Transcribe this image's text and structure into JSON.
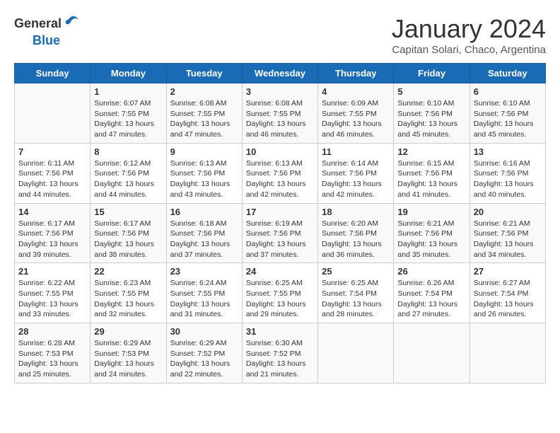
{
  "header": {
    "logo_general": "General",
    "logo_blue": "Blue",
    "title": "January 2024",
    "subtitle": "Capitan Solari, Chaco, Argentina"
  },
  "days": [
    "Sunday",
    "Monday",
    "Tuesday",
    "Wednesday",
    "Thursday",
    "Friday",
    "Saturday"
  ],
  "weeks": [
    [
      {
        "date": "",
        "info": ""
      },
      {
        "date": "1",
        "info": "Sunrise: 6:07 AM\nSunset: 7:55 PM\nDaylight: 13 hours\nand 47 minutes."
      },
      {
        "date": "2",
        "info": "Sunrise: 6:08 AM\nSunset: 7:55 PM\nDaylight: 13 hours\nand 47 minutes."
      },
      {
        "date": "3",
        "info": "Sunrise: 6:08 AM\nSunset: 7:55 PM\nDaylight: 13 hours\nand 46 minutes."
      },
      {
        "date": "4",
        "info": "Sunrise: 6:09 AM\nSunset: 7:55 PM\nDaylight: 13 hours\nand 46 minutes."
      },
      {
        "date": "5",
        "info": "Sunrise: 6:10 AM\nSunset: 7:56 PM\nDaylight: 13 hours\nand 45 minutes."
      },
      {
        "date": "6",
        "info": "Sunrise: 6:10 AM\nSunset: 7:56 PM\nDaylight: 13 hours\nand 45 minutes."
      }
    ],
    [
      {
        "date": "7",
        "info": "Sunrise: 6:11 AM\nSunset: 7:56 PM\nDaylight: 13 hours\nand 44 minutes."
      },
      {
        "date": "8",
        "info": "Sunrise: 6:12 AM\nSunset: 7:56 PM\nDaylight: 13 hours\nand 44 minutes."
      },
      {
        "date": "9",
        "info": "Sunrise: 6:13 AM\nSunset: 7:56 PM\nDaylight: 13 hours\nand 43 minutes."
      },
      {
        "date": "10",
        "info": "Sunrise: 6:13 AM\nSunset: 7:56 PM\nDaylight: 13 hours\nand 42 minutes."
      },
      {
        "date": "11",
        "info": "Sunrise: 6:14 AM\nSunset: 7:56 PM\nDaylight: 13 hours\nand 42 minutes."
      },
      {
        "date": "12",
        "info": "Sunrise: 6:15 AM\nSunset: 7:56 PM\nDaylight: 13 hours\nand 41 minutes."
      },
      {
        "date": "13",
        "info": "Sunrise: 6:16 AM\nSunset: 7:56 PM\nDaylight: 13 hours\nand 40 minutes."
      }
    ],
    [
      {
        "date": "14",
        "info": "Sunrise: 6:17 AM\nSunset: 7:56 PM\nDaylight: 13 hours\nand 39 minutes."
      },
      {
        "date": "15",
        "info": "Sunrise: 6:17 AM\nSunset: 7:56 PM\nDaylight: 13 hours\nand 38 minutes."
      },
      {
        "date": "16",
        "info": "Sunrise: 6:18 AM\nSunset: 7:56 PM\nDaylight: 13 hours\nand 37 minutes."
      },
      {
        "date": "17",
        "info": "Sunrise: 6:19 AM\nSunset: 7:56 PM\nDaylight: 13 hours\nand 37 minutes."
      },
      {
        "date": "18",
        "info": "Sunrise: 6:20 AM\nSunset: 7:56 PM\nDaylight: 13 hours\nand 36 minutes."
      },
      {
        "date": "19",
        "info": "Sunrise: 6:21 AM\nSunset: 7:56 PM\nDaylight: 13 hours\nand 35 minutes."
      },
      {
        "date": "20",
        "info": "Sunrise: 6:21 AM\nSunset: 7:56 PM\nDaylight: 13 hours\nand 34 minutes."
      }
    ],
    [
      {
        "date": "21",
        "info": "Sunrise: 6:22 AM\nSunset: 7:55 PM\nDaylight: 13 hours\nand 33 minutes."
      },
      {
        "date": "22",
        "info": "Sunrise: 6:23 AM\nSunset: 7:55 PM\nDaylight: 13 hours\nand 32 minutes."
      },
      {
        "date": "23",
        "info": "Sunrise: 6:24 AM\nSunset: 7:55 PM\nDaylight: 13 hours\nand 31 minutes."
      },
      {
        "date": "24",
        "info": "Sunrise: 6:25 AM\nSunset: 7:55 PM\nDaylight: 13 hours\nand 29 minutes."
      },
      {
        "date": "25",
        "info": "Sunrise: 6:25 AM\nSunset: 7:54 PM\nDaylight: 13 hours\nand 28 minutes."
      },
      {
        "date": "26",
        "info": "Sunrise: 6:26 AM\nSunset: 7:54 PM\nDaylight: 13 hours\nand 27 minutes."
      },
      {
        "date": "27",
        "info": "Sunrise: 6:27 AM\nSunset: 7:54 PM\nDaylight: 13 hours\nand 26 minutes."
      }
    ],
    [
      {
        "date": "28",
        "info": "Sunrise: 6:28 AM\nSunset: 7:53 PM\nDaylight: 13 hours\nand 25 minutes."
      },
      {
        "date": "29",
        "info": "Sunrise: 6:29 AM\nSunset: 7:53 PM\nDaylight: 13 hours\nand 24 minutes."
      },
      {
        "date": "30",
        "info": "Sunrise: 6:29 AM\nSunset: 7:52 PM\nDaylight: 13 hours\nand 22 minutes."
      },
      {
        "date": "31",
        "info": "Sunrise: 6:30 AM\nSunset: 7:52 PM\nDaylight: 13 hours\nand 21 minutes."
      },
      {
        "date": "",
        "info": ""
      },
      {
        "date": "",
        "info": ""
      },
      {
        "date": "",
        "info": ""
      }
    ]
  ]
}
